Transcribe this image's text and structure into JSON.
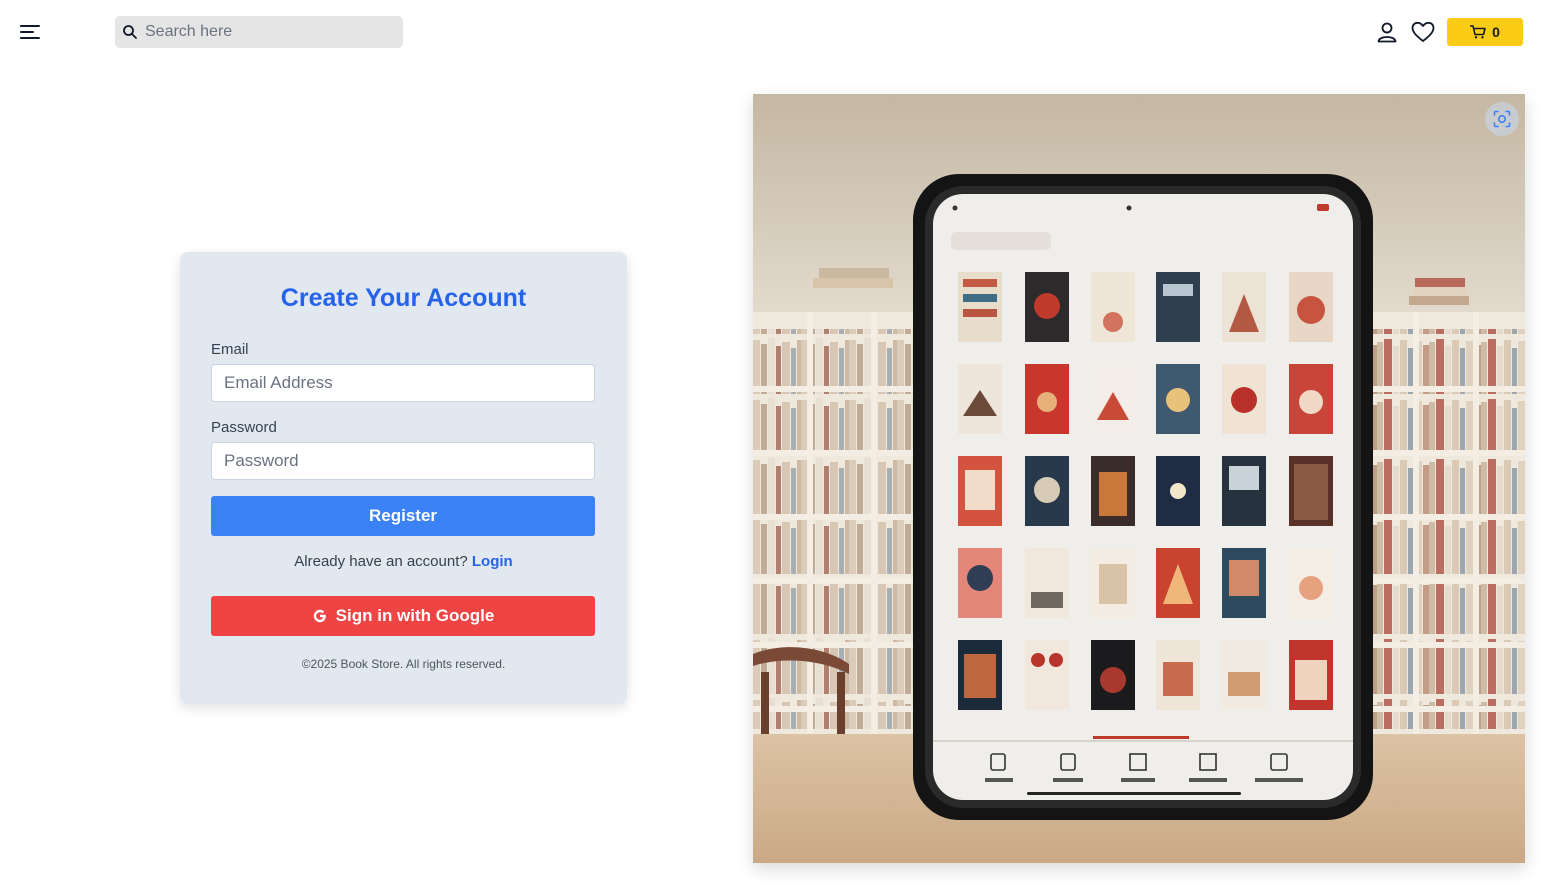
{
  "header": {
    "search_placeholder": "Search here",
    "cart_count": "0"
  },
  "form": {
    "title": "Create Your Account",
    "email_label": "Email",
    "email_placeholder": "Email Address",
    "password_label": "Password",
    "password_placeholder": "Password",
    "register_label": "Register",
    "login_prompt": "Already have an account?",
    "login_link": "Login",
    "google_label": "Sign in with Google",
    "footer": "©2025 Book Store. All rights reserved."
  },
  "colors": {
    "primary": "#3b82f6",
    "title": "#2563eb",
    "danger": "#ef4444",
    "cart": "#facc15",
    "card_bg": "#e2e8f0"
  },
  "icons": [
    "menu-icon",
    "search-icon",
    "user-icon",
    "heart-icon",
    "cart-icon",
    "google-icon",
    "visual-search-icon"
  ]
}
